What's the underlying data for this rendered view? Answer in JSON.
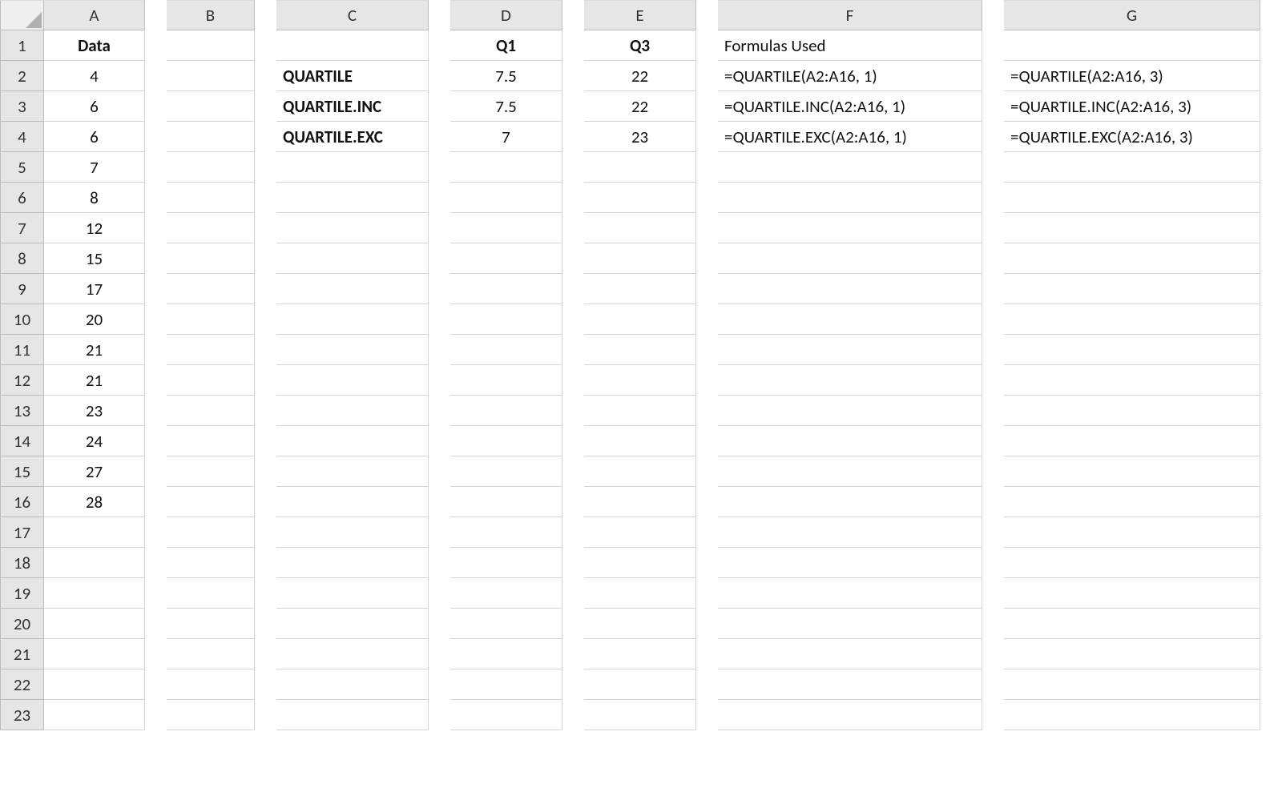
{
  "columns": [
    "A",
    "B",
    "C",
    "D",
    "E",
    "F",
    "G"
  ],
  "rowCount": 23,
  "headerRow": {
    "A": {
      "text": "Data",
      "bold": true,
      "align": "center"
    },
    "B": {
      "text": "",
      "bold": false,
      "align": "center"
    },
    "C": {
      "text": "",
      "bold": false,
      "align": "center"
    },
    "D": {
      "text": "Q1",
      "bold": true,
      "align": "center"
    },
    "E": {
      "text": "Q3",
      "bold": true,
      "align": "center"
    },
    "F": {
      "text": "Formulas Used",
      "bold": false,
      "align": "left"
    },
    "G": {
      "text": "",
      "bold": false,
      "align": "left"
    }
  },
  "dataColumn": [
    4,
    6,
    6,
    7,
    8,
    12,
    15,
    17,
    20,
    21,
    21,
    23,
    24,
    27,
    28
  ],
  "quartileRows": [
    {
      "label": "QUARTILE",
      "q1": "7.5",
      "q3": "22",
      "formulaF": "=QUARTILE(A2:A16, 1)",
      "formulaG": "=QUARTILE(A2:A16, 3)"
    },
    {
      "label": "QUARTILE.INC",
      "q1": "7.5",
      "q3": "22",
      "formulaF": "=QUARTILE.INC(A2:A16, 1)",
      "formulaG": "=QUARTILE.INC(A2:A16, 3)"
    },
    {
      "label": "QUARTILE.EXC",
      "q1": "7",
      "q3": "23",
      "formulaF": "=QUARTILE.EXC(A2:A16, 1)",
      "formulaG": "=QUARTILE.EXC(A2:A16, 3)"
    }
  ]
}
